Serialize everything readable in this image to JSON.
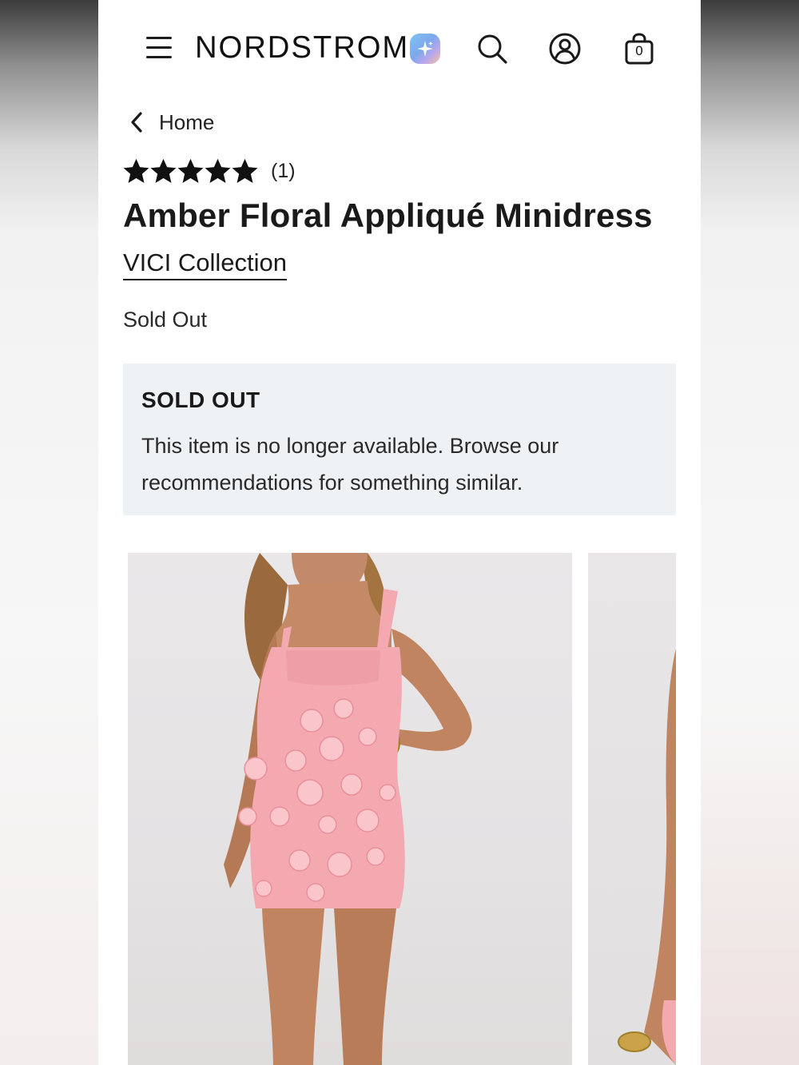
{
  "header": {
    "logo": "NORDSTROM",
    "bag_count": "0",
    "icons": [
      "hamburger-menu-icon",
      "sparkle-ai-icon",
      "search-icon",
      "account-icon",
      "shopping-bag-icon"
    ]
  },
  "breadcrumb": {
    "label": "Home",
    "icon": "chevron-left-icon"
  },
  "product": {
    "rating": 5,
    "rating_max": 5,
    "review_count": "(1)",
    "title": "Amber Floral Appliqué Minidress",
    "brand": "VICI Collection",
    "price_status": "Sold Out"
  },
  "notice": {
    "title": "SOLD OUT",
    "body": "This item is no longer available. Browse our recommendations for something similar."
  },
  "gallery": {
    "images": [
      "product-photo-front",
      "product-photo-side"
    ],
    "dress_color": "#f4a9b1"
  },
  "colors": {
    "notice_background": "#eff2f5",
    "text": "#1a1a1a"
  }
}
